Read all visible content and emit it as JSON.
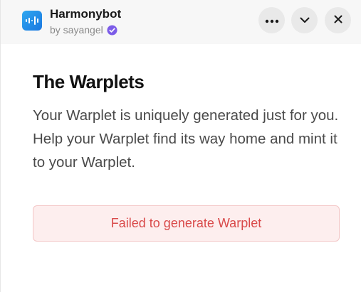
{
  "header": {
    "app_name": "Harmonybot",
    "byline": "by sayangel",
    "icons": {
      "app": "harmonybot-logo-icon",
      "verified": "verified-badge-icon",
      "more": "more-horizontal-icon",
      "collapse": "chevron-down-icon",
      "close": "close-icon"
    }
  },
  "main": {
    "title": "The Warplets",
    "description": "Your Warplet is uniquely generated just for you. Help your Warplet find its way home and mint it to your Warplet.",
    "error_message": "Failed to generate Warplet"
  },
  "colors": {
    "accent": "#1c78e0",
    "verified": "#7c5ce8",
    "error_text": "#d94a4a",
    "error_bg": "#fdeeee"
  }
}
